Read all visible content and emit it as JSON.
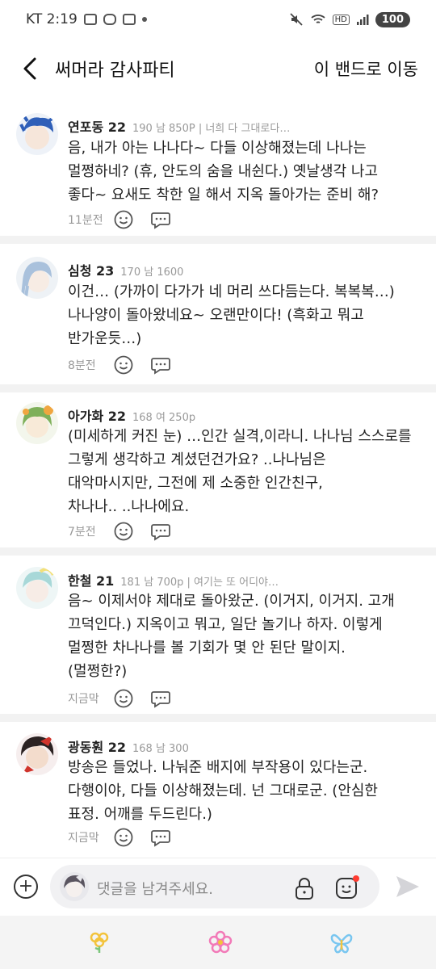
{
  "status_bar": {
    "carrier_time": "KT 2:19",
    "hd": "HD",
    "battery": "100"
  },
  "header": {
    "title": "써머라 감사파티",
    "action": "이 밴드로 이동"
  },
  "comments": [
    {
      "nick": "연포동 22",
      "info": "190 남 850P | 너희 다 그대로다…",
      "lines": [
        "음, 내가 아는 나나다~ 다들 이상해졌는데 나나는",
        "멀쩡하네? (휴, 안도의 숨을 내쉰다.) 옛날생각 나고",
        "좋다~ 요새도 착한 일 해서 지옥 돌아가는 준비 해?"
      ],
      "time": "11분전"
    },
    {
      "nick": "심청 23",
      "info": "170 남 1600",
      "lines": [
        "이건… (가까이 다가가 네 머리 쓰다듬는다. 복복복…)",
        "나나양이 돌아왔네요~ 오랜만이다! (흑화고 뭐고",
        "반가운듯…)"
      ],
      "time": "8분전"
    },
    {
      "nick": "아가화 22",
      "info": "168 여 250p",
      "lines": [
        "(미세하게 커진 눈) …인간 실격,이라니. 나나님 스스로를",
        "그렇게 생각하고 계셨던건가요? ..나나님은",
        "대악마시지만, 그전에 제 소중한 인간친구,",
        "차나나.. ..나나에요."
      ],
      "time": "7분전"
    },
    {
      "nick": "한철 21",
      "info": "181 남 700p | 여기는 또 어디야…",
      "lines": [
        "음~ 이제서야 제대로 돌아왔군. (이거지, 이거지. 고개",
        "끄덕인다.) 지옥이고 뭐고, 일단 놀기나 하자. 이렇게",
        "멀쩡한 차나나를 볼 기회가 몇 안 된단 말이지.",
        "(멀쩡한?)"
      ],
      "time": "지금막"
    },
    {
      "nick": "광동훤 22",
      "info": "168 남 300",
      "lines": [
        "방송은 들었나. 나눠준 배지에 부작용이 있다는군.",
        "다행이야, 다들 이상해졌는데. 넌 그대로군. (안심한",
        "표정. 어깨를 두드린다.)"
      ],
      "time": "지금막"
    }
  ],
  "composer": {
    "placeholder": "댓글을 남겨주세요."
  },
  "icons": {
    "back": "chevron-left-icon",
    "emoji": "smiley-icon",
    "reply": "speech-bubble-icon",
    "add": "plus-circle-icon",
    "lock": "lock-icon",
    "sticker": "sticker-icon",
    "send": "send-icon",
    "nav": [
      "flower-yellow-icon",
      "flower-pink-icon",
      "butterfly-blue-icon"
    ]
  },
  "colors": {
    "nav_yellow": "#f3c33b",
    "nav_pink": "#f27ab8",
    "nav_blue": "#79c6f0",
    "sticker_dot": "#ff3b30"
  }
}
